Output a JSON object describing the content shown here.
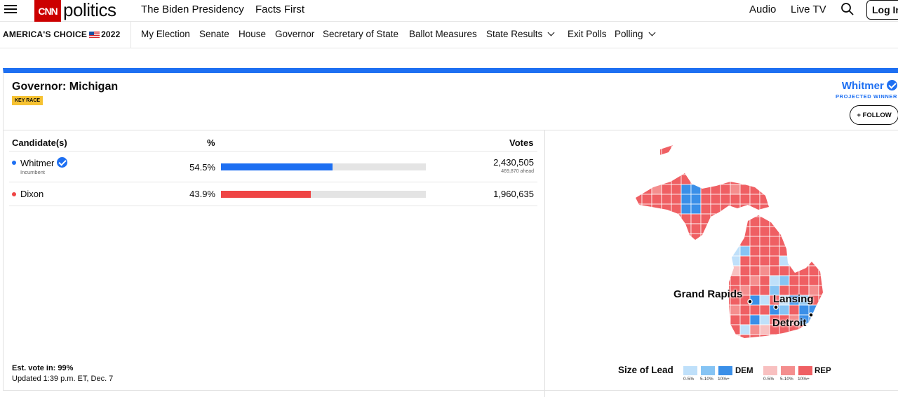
{
  "header": {
    "logo_text": "CNN",
    "section": "politics",
    "nav": [
      "The Biden Presidency",
      "Facts First"
    ],
    "right_links": [
      "Audio",
      "Live TV"
    ],
    "login_label": "Log In"
  },
  "subnav": {
    "brand": "AMERICA'S CHOICE",
    "year": "2022",
    "items": [
      "My Election",
      "Senate",
      "House",
      "Governor",
      "Secretary of State",
      "Ballot Measures",
      "State Results",
      "Exit Polls",
      "Polling"
    ]
  },
  "race": {
    "title": "Governor: Michigan",
    "badge": "KEY RACE",
    "winner_name": "Whitmer",
    "winner_label": "PROJECTED WINNER",
    "follow_label": "+ FOLLOW",
    "columns": {
      "candidates": "Candidate(s)",
      "pct": "%",
      "votes": "Votes"
    },
    "candidates": [
      {
        "name": "Whitmer",
        "note": "Incumbent",
        "pct": "54.5%",
        "pct_value": 54.5,
        "votes": "2,430,505",
        "ahead": "469,870 ahead",
        "color": "#1d6ff2"
      },
      {
        "name": "Dixon",
        "note": "",
        "pct": "43.9%",
        "pct_value": 43.9,
        "votes": "1,960,635",
        "ahead": "",
        "color": "#ef4444"
      }
    ],
    "est_vote": "Est. vote in: 99%",
    "updated": "Updated 1:39 p.m. ET, Dec. 7"
  },
  "map": {
    "cities": [
      "Grand Rapids",
      "Lansing",
      "Detroit"
    ],
    "legend_title": "Size of Lead",
    "dem_label": "DEM",
    "rep_label": "REP",
    "ranges": [
      "0-5%",
      "5-10%",
      "10%+"
    ],
    "colors": {
      "dem": [
        "#bfe0fa",
        "#86c4f4",
        "#3a8fe8"
      ],
      "rep": [
        "#f8c0c0",
        "#f48e8e",
        "#ef5f63"
      ]
    }
  }
}
